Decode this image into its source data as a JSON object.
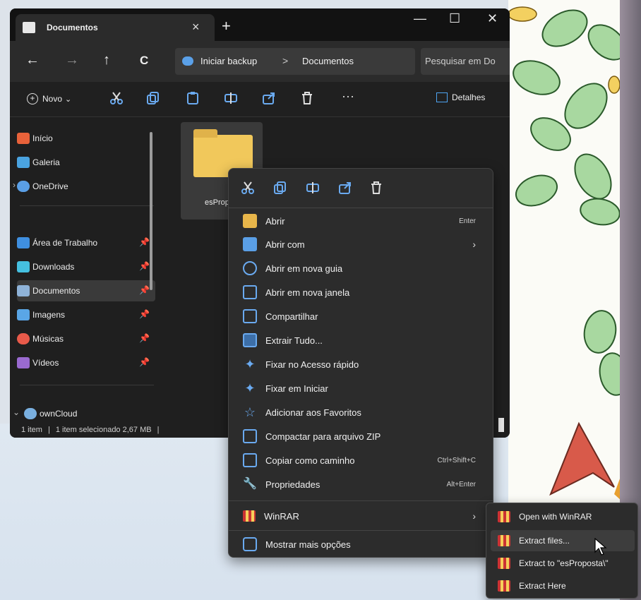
{
  "window": {
    "tab_title": "Documentos",
    "tab_close": "×",
    "tab_add": "+",
    "controls": {
      "minimize": "—",
      "maximize": "☐",
      "close": "✕"
    }
  },
  "nav": {
    "back": "←",
    "forward": "→",
    "up": "↑",
    "refresh": "C",
    "breadcrumb_root": "Iniciar backup",
    "breadcrumb_sep": ">",
    "breadcrumb_current": "Documentos",
    "search_placeholder": "Pesquisar em Do"
  },
  "toolbar": {
    "new_label": "Novo",
    "new_chevron": "⌄",
    "more": "···",
    "details_label": "Detalhes"
  },
  "sidebar": {
    "items": [
      {
        "label": "Início",
        "icon": "home-icon",
        "color": "#e8623a"
      },
      {
        "label": "Galeria",
        "icon": "gallery-icon",
        "color": "#4aa3e0"
      },
      {
        "label": "OneDrive",
        "icon": "cloud-icon",
        "color": "#5a9fe6"
      },
      {
        "label": "Área de Trabalho",
        "icon": "desktop-icon",
        "color": "#3f8fe0"
      },
      {
        "label": "Downloads",
        "icon": "download-icon",
        "color": "#45c0e0"
      },
      {
        "label": "Documentos",
        "icon": "documents-icon",
        "color": "#8fb3d8"
      },
      {
        "label": "Imagens",
        "icon": "images-icon",
        "color": "#5aa6e6"
      },
      {
        "label": "Músicas",
        "icon": "music-icon",
        "color": "#e85a4a"
      },
      {
        "label": "Vídeos",
        "icon": "videos-icon",
        "color": "#9a6ad0"
      },
      {
        "label": "ownCloud",
        "icon": "owncloud-icon",
        "color": "#7ab0e0"
      }
    ],
    "pin": "📌",
    "chevron_right": "›",
    "chevron_down": "⌄"
  },
  "content": {
    "file_name": "esPropo"
  },
  "status": {
    "count": "1 item",
    "sep": "|",
    "selected": "1 item selecionado 2,67 MB",
    "sep2": "|"
  },
  "context_menu": {
    "items": [
      {
        "label": "Abrir",
        "shortcut": "Enter",
        "icon": "folder-open-icon",
        "color": "#e8b64a"
      },
      {
        "label": "Abrir com",
        "arrow": "›",
        "icon": "open-with-icon",
        "color": "#5a9fe6"
      },
      {
        "label": "Abrir em nova guia",
        "icon": "new-tab-icon",
        "color": "#6aaaf0"
      },
      {
        "label": "Abrir em nova janela",
        "icon": "new-window-icon",
        "color": "#6aaaf0"
      },
      {
        "label": "Compartilhar",
        "icon": "share-icon",
        "color": "#6aaaf0"
      },
      {
        "label": "Extrair Tudo...",
        "icon": "extract-icon",
        "color": "#6aaaf0"
      },
      {
        "label": "Fixar no Acesso rápido",
        "icon": "pin-icon",
        "color": "#6aaaf0"
      },
      {
        "label": "Fixar em Iniciar",
        "icon": "pin-start-icon",
        "color": "#6aaaf0"
      },
      {
        "label": "Adicionar aos Favoritos",
        "icon": "star-icon",
        "color": "#6aaaf0"
      },
      {
        "label": "Compactar para arquivo ZIP",
        "icon": "zip-icon",
        "color": "#6aaaf0"
      },
      {
        "label": "Copiar como caminho",
        "shortcut": "Ctrl+Shift+C",
        "icon": "copy-path-icon",
        "color": "#6aaaf0"
      },
      {
        "label": "Propriedades",
        "shortcut": "Alt+Enter",
        "icon": "wrench-icon",
        "color": "#6aaaf0"
      },
      {
        "label": "WinRAR",
        "arrow": "›",
        "icon": "winrar-icon",
        "color": "#d04040"
      },
      {
        "label": "Mostrar mais opções",
        "icon": "more-options-icon",
        "color": "#6aaaf0"
      }
    ]
  },
  "winrar_submenu": {
    "items": [
      {
        "label": "Open with WinRAR"
      },
      {
        "label": "Extract files..."
      },
      {
        "label": "Extract to \"esProposta\\\""
      },
      {
        "label": "Extract Here"
      }
    ]
  }
}
